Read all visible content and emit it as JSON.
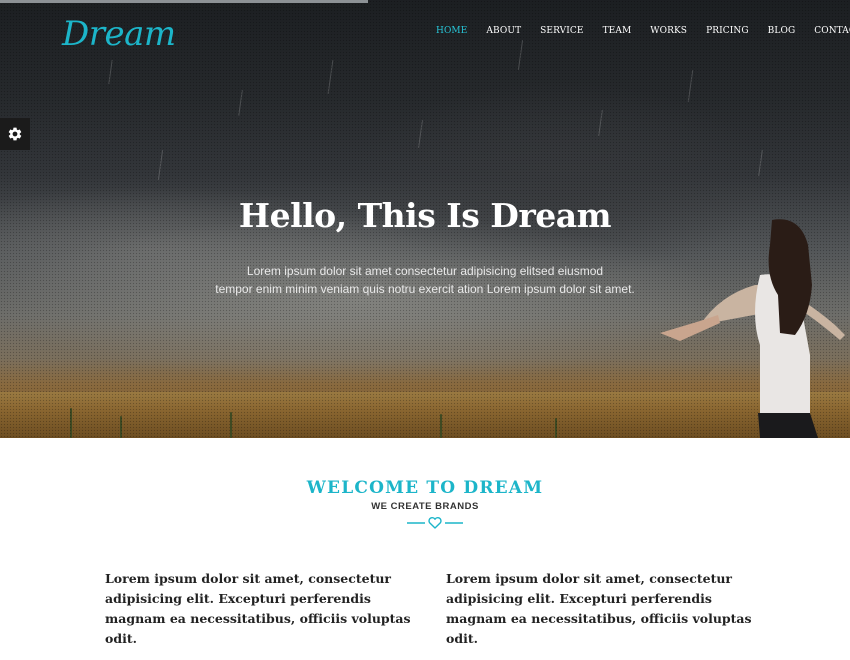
{
  "brand": {
    "logo": "Dream",
    "accent": "#1cb5c9"
  },
  "nav": {
    "items": [
      {
        "label": "HOME",
        "active": true
      },
      {
        "label": "ABOUT"
      },
      {
        "label": "SERVICE"
      },
      {
        "label": "TEAM"
      },
      {
        "label": "WORKS"
      },
      {
        "label": "PRICING"
      },
      {
        "label": "BLOG"
      },
      {
        "label": "CONTACT"
      }
    ]
  },
  "settings": {
    "icon": "gear-icon"
  },
  "hero": {
    "title": "Hello, This Is Dream",
    "line1": "Lorem ipsum dolor sit amet consectetur adipisicing elitsed eiusmod",
    "line2": "tempor enim minim veniam quis notru exercit ation Lorem ipsum dolor sit amet."
  },
  "welcome": {
    "title": "WELCOME TO DREAM",
    "subtitle": "WE CREATE BRANDS",
    "divider_icon": "heart-icon"
  },
  "columns": [
    {
      "text": "Lorem ipsum dolor sit amet, consectetur adipisicing elit. Excepturi perferendis magnam ea necessitatibus, officiis voluptas odit."
    },
    {
      "text": "Lorem ipsum dolor sit amet, consectetur adipisicing elit. Excepturi perferendis magnam ea necessitatibus, officiis voluptas odit."
    }
  ]
}
